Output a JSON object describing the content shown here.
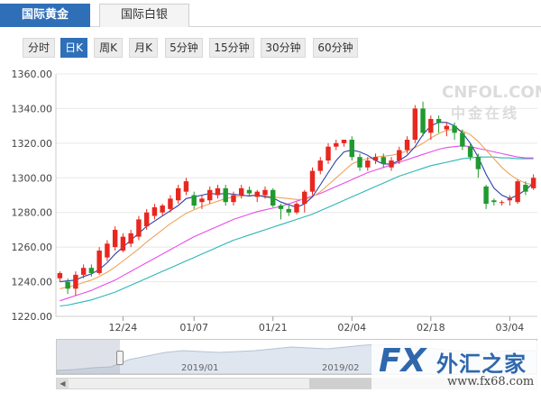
{
  "tabs": [
    {
      "label": "国际黄金",
      "active": true
    },
    {
      "label": "国际白银",
      "active": false
    }
  ],
  "periods": [
    {
      "label": "分时",
      "active": false
    },
    {
      "label": "日K",
      "active": true
    },
    {
      "label": "周K",
      "active": false
    },
    {
      "label": "月K",
      "active": false
    },
    {
      "label": "5分钟",
      "active": false
    },
    {
      "label": "15分钟",
      "active": false
    },
    {
      "label": "30分钟",
      "active": false
    },
    {
      "label": "60分钟",
      "active": false
    }
  ],
  "watermark": {
    "line1": "CNFOL.COM",
    "line2": "中金在线"
  },
  "navigator": {
    "labels": [
      "2019/01",
      "2019/02"
    ]
  },
  "logo": {
    "fx": "FX",
    "cn": "外汇之家",
    "url": "www.fx68.com"
  },
  "colors": {
    "up": "#e8271f",
    "down": "#1f9a2f",
    "ma5": "#2b3fa8",
    "ma10": "#f0a35a",
    "ma20": "#e84ce8",
    "ma30": "#2eb5b5",
    "accent": "#2f6fb8"
  },
  "chart_data": {
    "type": "candlestick",
    "ylim": [
      1220,
      1360
    ],
    "yticks": [
      "1360.00",
      "1340.00",
      "1320.00",
      "1300.00",
      "1280.00",
      "1260.00",
      "1240.00",
      "1220.00"
    ],
    "xticks": [
      {
        "label": "12/24",
        "index": 8
      },
      {
        "label": "01/07",
        "index": 17
      },
      {
        "label": "01/21",
        "index": 27
      },
      {
        "label": "02/04",
        "index": 37
      },
      {
        "label": "02/18",
        "index": 47
      },
      {
        "label": "03/04",
        "index": 57
      }
    ],
    "candles": [
      [
        1242,
        1245,
        1240,
        1246
      ],
      [
        1240,
        1236,
        1233,
        1242
      ],
      [
        1236,
        1244,
        1232,
        1246
      ],
      [
        1244,
        1248,
        1242,
        1250
      ],
      [
        1248,
        1245,
        1243,
        1250
      ],
      [
        1245,
        1258,
        1244,
        1260
      ],
      [
        1254,
        1262,
        1252,
        1264
      ],
      [
        1260,
        1270,
        1258,
        1272
      ],
      [
        1258,
        1266,
        1257,
        1268
      ],
      [
        1262,
        1268,
        1260,
        1270
      ],
      [
        1266,
        1276,
        1264,
        1278
      ],
      [
        1272,
        1280,
        1270,
        1282
      ],
      [
        1278,
        1283,
        1276,
        1285
      ],
      [
        1280,
        1284,
        1278,
        1285
      ],
      [
        1282,
        1288,
        1280,
        1290
      ],
      [
        1287,
        1294,
        1285,
        1296
      ],
      [
        1292,
        1298,
        1290,
        1300
      ],
      [
        1290,
        1284,
        1282,
        1292
      ],
      [
        1286,
        1288,
        1282,
        1290
      ],
      [
        1287,
        1293,
        1285,
        1295
      ],
      [
        1290,
        1294,
        1288,
        1296
      ],
      [
        1294,
        1286,
        1284,
        1296
      ],
      [
        1286,
        1290,
        1284,
        1292
      ],
      [
        1290,
        1294,
        1288,
        1296
      ],
      [
        1293,
        1291,
        1290,
        1295
      ],
      [
        1289,
        1292,
        1286,
        1293
      ],
      [
        1290,
        1293,
        1288,
        1295
      ],
      [
        1293,
        1284,
        1283,
        1294
      ],
      [
        1284,
        1282,
        1276,
        1285
      ],
      [
        1282,
        1280,
        1278,
        1284
      ],
      [
        1280,
        1285,
        1279,
        1286
      ],
      [
        1285,
        1292,
        1280,
        1293
      ],
      [
        1292,
        1304,
        1290,
        1306
      ],
      [
        1304,
        1310,
        1302,
        1312
      ],
      [
        1310,
        1318,
        1308,
        1320
      ],
      [
        1318,
        1320,
        1316,
        1322
      ],
      [
        1320,
        1322,
        1318,
        1322
      ],
      [
        1322,
        1312,
        1310,
        1324
      ],
      [
        1312,
        1306,
        1304,
        1314
      ],
      [
        1306,
        1310,
        1304,
        1312
      ],
      [
        1310,
        1312,
        1308,
        1314
      ],
      [
        1312,
        1308,
        1306,
        1314
      ],
      [
        1306,
        1310,
        1304,
        1312
      ],
      [
        1310,
        1316,
        1308,
        1318
      ],
      [
        1316,
        1322,
        1314,
        1324
      ],
      [
        1322,
        1340,
        1320,
        1342
      ],
      [
        1340,
        1326,
        1324,
        1344
      ],
      [
        1326,
        1334,
        1322,
        1336
      ],
      [
        1334,
        1332,
        1326,
        1336
      ],
      [
        1328,
        1330,
        1324,
        1332
      ],
      [
        1330,
        1326,
        1322,
        1332
      ],
      [
        1326,
        1318,
        1316,
        1328
      ],
      [
        1318,
        1312,
        1310,
        1320
      ],
      [
        1312,
        1305,
        1300,
        1314
      ],
      [
        1295,
        1285,
        1282,
        1296
      ],
      [
        1287,
        1286,
        1284,
        1288
      ],
      [
        1286,
        1286,
        1284,
        1287
      ],
      [
        1287,
        1288,
        1284,
        1290
      ],
      [
        1286,
        1298,
        1285,
        1299
      ],
      [
        1296,
        1292,
        1290,
        1298
      ],
      [
        1294,
        1300,
        1293,
        1302
      ]
    ],
    "series": [
      {
        "name": "MA5",
        "values": [
          1240,
          1240.5,
          1241,
          1243,
          1244.5,
          1247,
          1251,
          1256,
          1260,
          1264,
          1268,
          1272,
          1275,
          1278,
          1281,
          1284,
          1288,
          1289,
          1290,
          1291,
          1290.5,
          1291,
          1290.5,
          1290,
          1289.5,
          1290,
          1289,
          1288.5,
          1286,
          1284.5,
          1283,
          1285,
          1289,
          1296,
          1303,
          1310,
          1315,
          1316,
          1315,
          1313,
          1310,
          1308,
          1308,
          1310,
          1313,
          1318,
          1325,
          1330,
          1332,
          1332,
          1330,
          1326,
          1320,
          1312,
          1302,
          1294,
          1290,
          1288,
          1290,
          1293,
          1297
        ]
      },
      {
        "name": "MA10",
        "values": [
          1236,
          1237,
          1238,
          1239.5,
          1241,
          1243,
          1245.5,
          1248.5,
          1252,
          1255.5,
          1259,
          1263,
          1266.5,
          1270,
          1273.5,
          1276.5,
          1279.5,
          1281.5,
          1283.5,
          1285,
          1286.5,
          1288,
          1289,
          1289.5,
          1290,
          1290,
          1289.5,
          1289,
          1288.5,
          1288,
          1287.5,
          1287.5,
          1289,
          1292,
          1296,
          1300,
          1304,
          1308,
          1310,
          1311,
          1312,
          1312.5,
          1313,
          1314,
          1315.5,
          1317.5,
          1320,
          1323,
          1325.5,
          1327.5,
          1328,
          1327,
          1325,
          1321,
          1316,
          1311,
          1306,
          1302,
          1299,
          1297,
          1296
        ]
      },
      {
        "name": "MA20",
        "values": [
          1229,
          1230.5,
          1232,
          1233.5,
          1235,
          1237,
          1239,
          1241,
          1243.5,
          1246,
          1248.5,
          1251,
          1253.5,
          1256,
          1258.5,
          1261,
          1263.5,
          1266,
          1268,
          1270,
          1272,
          1274,
          1276,
          1277.5,
          1279,
          1280.5,
          1281.5,
          1282.5,
          1283.5,
          1285,
          1286.5,
          1288,
          1289.5,
          1291,
          1293,
          1295,
          1297,
          1299,
          1301,
          1303,
          1304.5,
          1306,
          1307.5,
          1309,
          1310.5,
          1312,
          1313.5,
          1315,
          1316.5,
          1317.5,
          1318,
          1318.5,
          1318,
          1317,
          1316,
          1315,
          1314,
          1313,
          1312,
          1311.5,
          1311.5
        ]
      },
      {
        "name": "MA30",
        "values": [
          1226,
          1226.5,
          1227.5,
          1228.5,
          1229.5,
          1231,
          1232.5,
          1234,
          1236,
          1238,
          1240,
          1242,
          1244,
          1246,
          1248,
          1250,
          1252,
          1254,
          1256,
          1258,
          1260,
          1262,
          1264,
          1265.5,
          1267,
          1268.5,
          1270,
          1271.5,
          1273,
          1274.5,
          1276,
          1277.5,
          1279,
          1281,
          1283,
          1285,
          1287,
          1289,
          1291,
          1293,
          1295,
          1297,
          1299,
          1301,
          1302.5,
          1304,
          1305.5,
          1307,
          1308,
          1309,
          1310,
          1311,
          1311.5,
          1312,
          1312,
          1312,
          1311.5,
          1311.5,
          1311,
          1311,
          1311
        ]
      }
    ]
  }
}
